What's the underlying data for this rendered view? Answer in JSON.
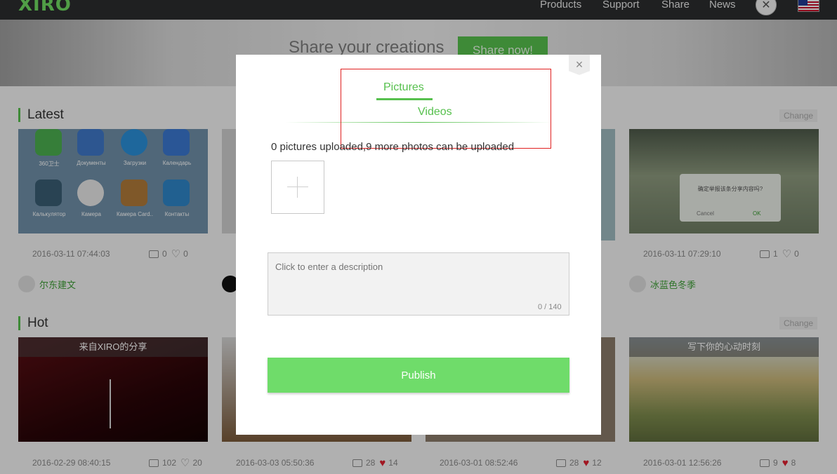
{
  "nav": {
    "logo": "XIRO",
    "items": [
      "Products",
      "Support",
      "Share",
      "News"
    ]
  },
  "banner": {
    "title": "Share your creations",
    "button": "Share now!"
  },
  "latest": {
    "title": "Latest",
    "change": "Change",
    "cards": [
      {
        "date": "2016-03-11 07:44:03",
        "comments": "0",
        "likes": "0",
        "user": "尔东建文"
      },
      {
        "date": "2016-03-11 07:29:10",
        "comments": "1",
        "likes": "0",
        "user": "冰蓝色冬季"
      }
    ],
    "phone_apps": [
      "360卫士",
      "Документы",
      "Загрузки",
      "Календарь",
      "Калькулятор",
      "Камера",
      "Камера Card..",
      "Контакты"
    ],
    "dialog_card": {
      "question": "确定举报该条分享内容吗?",
      "cancel": "Cancel",
      "ok": "OK"
    }
  },
  "hot": {
    "title": "Hot",
    "change": "Change",
    "cards": [
      {
        "caption": "来自XIRO的分享",
        "date": "2016-02-29 08:40:15",
        "comments": "102",
        "likes": "20"
      },
      {
        "caption": "",
        "date": "2016-03-03 05:50:36",
        "comments": "28",
        "likes": "14"
      },
      {
        "caption": "",
        "date": "2016-03-01 08:52:46",
        "comments": "28",
        "likes": "12"
      },
      {
        "caption": "写下你的心动时刻",
        "date": "2016-03-01 12:56:26",
        "comments": "9",
        "likes": "8"
      }
    ]
  },
  "modal": {
    "close": "×",
    "tabs": {
      "pictures": "Pictures",
      "videos": "Videos"
    },
    "upload_status": "0 pictures uploaded,9 more photos can be uploaded",
    "description_placeholder": "Click to enter a description",
    "counter": "0 / 140",
    "publish": "Publish"
  },
  "colors": {
    "accent": "#56c04d",
    "publish": "#6fdc6a",
    "highlight": "#e02020"
  }
}
